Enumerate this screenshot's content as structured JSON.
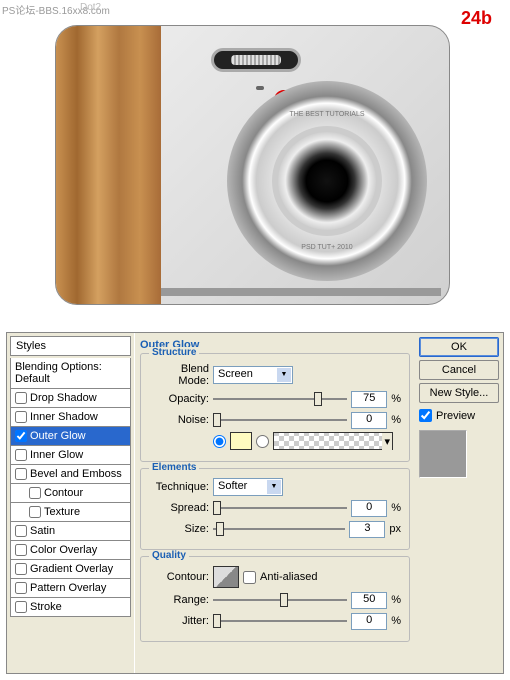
{
  "watermark": "PS论坛-BBS.16xx8.com",
  "title": "Dot2",
  "step": "24b",
  "lens_text_top": "THE BEST TUTORIALS",
  "lens_text_bot": "PSD TUT+ 2010",
  "dialog": {
    "styles_header": "Styles",
    "blending_row": "Blending Options: Default",
    "effects": [
      {
        "label": "Drop Shadow",
        "checked": false,
        "sel": false
      },
      {
        "label": "Inner Shadow",
        "checked": false,
        "sel": false
      },
      {
        "label": "Outer Glow",
        "checked": true,
        "sel": true
      },
      {
        "label": "Inner Glow",
        "checked": false,
        "sel": false
      },
      {
        "label": "Bevel and Emboss",
        "checked": false,
        "sel": false
      },
      {
        "label": "Contour",
        "checked": false,
        "sel": false,
        "indent": true
      },
      {
        "label": "Texture",
        "checked": false,
        "sel": false,
        "indent": true
      },
      {
        "label": "Satin",
        "checked": false,
        "sel": false
      },
      {
        "label": "Color Overlay",
        "checked": false,
        "sel": false
      },
      {
        "label": "Gradient Overlay",
        "checked": false,
        "sel": false
      },
      {
        "label": "Pattern Overlay",
        "checked": false,
        "sel": false
      },
      {
        "label": "Stroke",
        "checked": false,
        "sel": false
      }
    ],
    "panel_title": "Outer Glow",
    "structure": {
      "title": "Structure",
      "blend_label": "Blend Mode:",
      "blend_value": "Screen",
      "opacity_label": "Opacity:",
      "opacity_value": "75",
      "opacity_unit": "%",
      "noise_label": "Noise:",
      "noise_value": "0",
      "noise_unit": "%"
    },
    "elements": {
      "title": "Elements",
      "tech_label": "Technique:",
      "tech_value": "Softer",
      "spread_label": "Spread:",
      "spread_value": "0",
      "spread_unit": "%",
      "size_label": "Size:",
      "size_value": "3",
      "size_unit": "px"
    },
    "quality": {
      "title": "Quality",
      "contour_label": "Contour:",
      "aa_label": "Anti-aliased",
      "range_label": "Range:",
      "range_value": "50",
      "range_unit": "%",
      "jitter_label": "Jitter:",
      "jitter_value": "0",
      "jitter_unit": "%"
    },
    "buttons": {
      "ok": "OK",
      "cancel": "Cancel",
      "newstyle": "New Style...",
      "preview": "Preview"
    }
  }
}
